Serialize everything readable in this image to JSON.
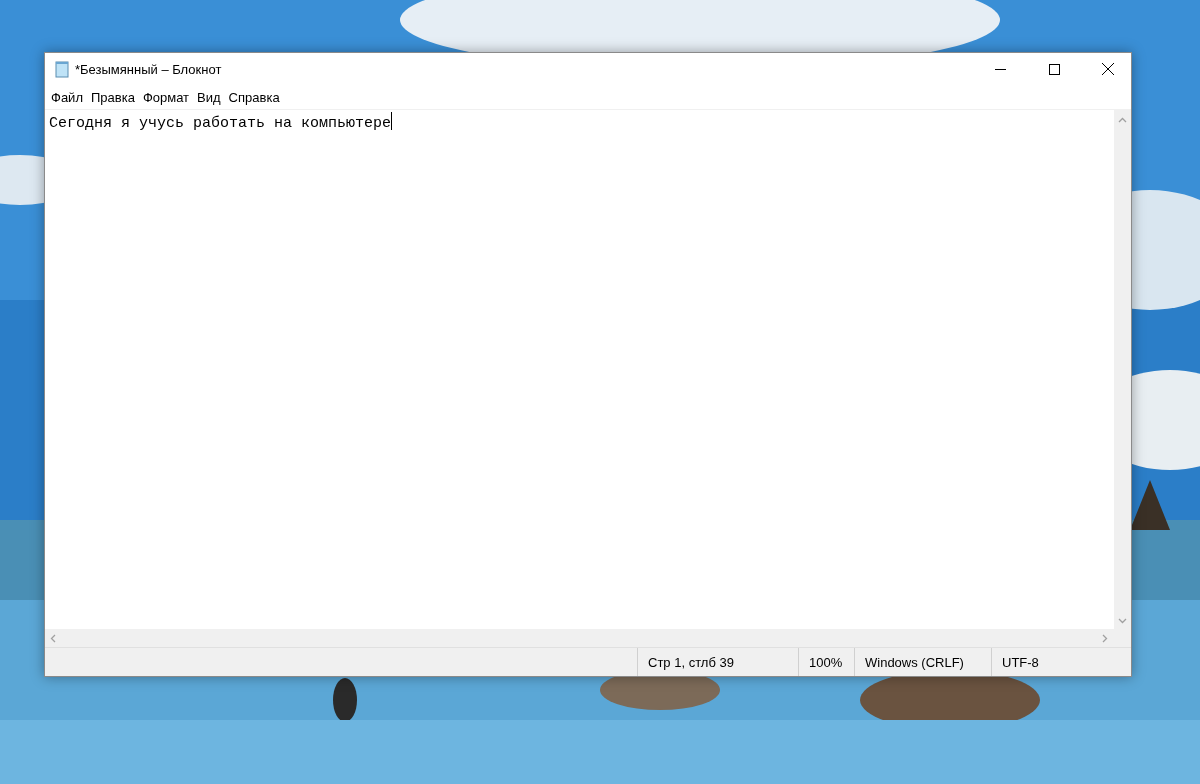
{
  "window": {
    "title": "*Безымянный – Блокнот"
  },
  "menu": [
    "Файл",
    "Правка",
    "Формат",
    "Вид",
    "Справка"
  ],
  "editor": {
    "text": "Сегодня я учусь работать на компьютере"
  },
  "status_bar": [
    "Стр 1, стлб 39",
    "100%",
    "Windows (CRLF)",
    "UTF-8"
  ]
}
